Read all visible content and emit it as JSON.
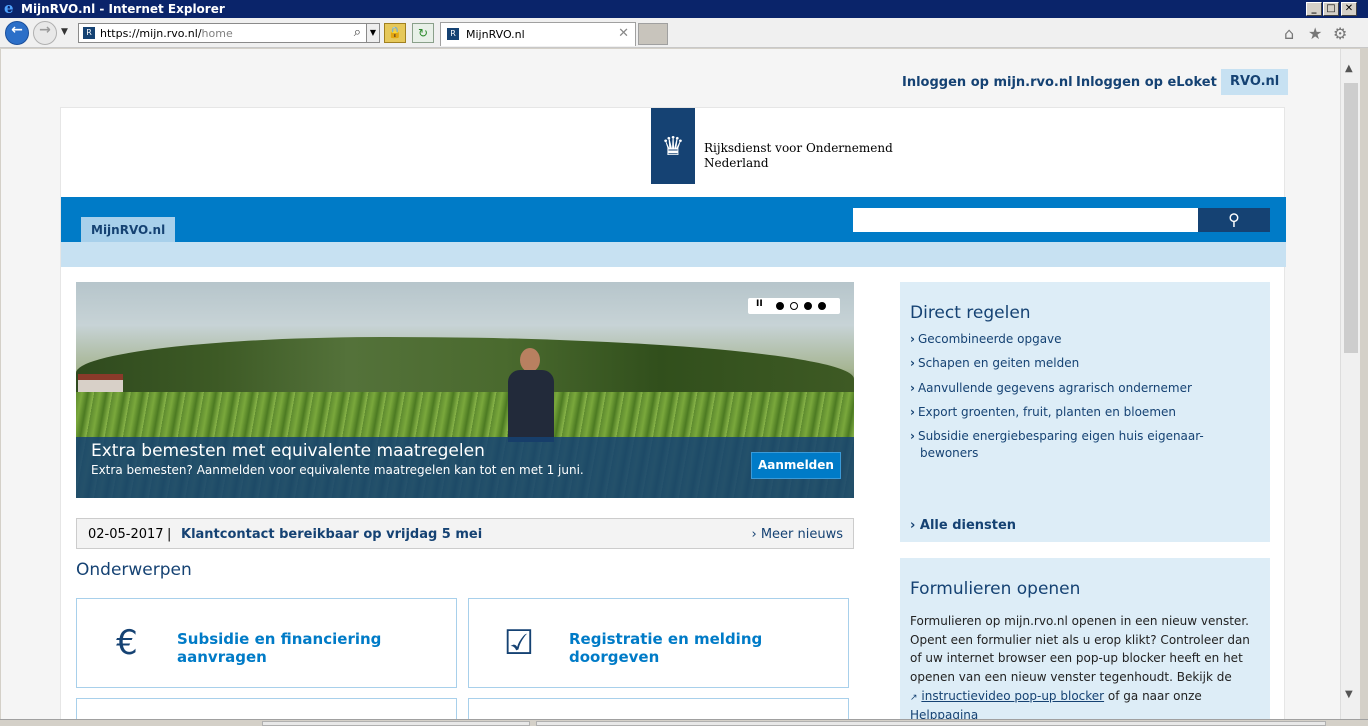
{
  "window": {
    "title": "MijnRVO.nl - Internet Explorer",
    "minimize": "_",
    "maximize": "□",
    "close": "✕"
  },
  "browser": {
    "back": "←",
    "forward": "→",
    "history_dropdown": "▼",
    "url_host": "https://mijn.rvo.nl/",
    "url_path": "home",
    "search_icon": "⌕",
    "address_dropdown": "▼",
    "lock_icon": "🔒",
    "refresh_icon": "↻",
    "tab_label": "MijnRVO.nl",
    "tab_close": "✕",
    "home_icon": "⌂",
    "favorites_icon": "★",
    "settings_icon": "⚙",
    "site_icon": "R"
  },
  "page": {
    "top_links": [
      "Inloggen op mijn.rvo.nl",
      "Inloggen op eLoket",
      "RVO.nl"
    ],
    "logo_line1": "Rijksdienst voor Ondernemend",
    "logo_line2": "Nederland",
    "logo_crest": "♛",
    "nav_home": "MijnRVO.nl",
    "search_placeholder": "",
    "search_icon": "⚲",
    "hero": {
      "title": "Extra bemesten met equivalente maatregelen",
      "subtitle": "Extra bemesten? Aanmelden voor equivalente maatregelen kan tot en met 1 juni.",
      "button": "Aanmelden",
      "pause": "II",
      "active_slide": 2,
      "slide_count": 4
    },
    "news": {
      "date": "02-05-2017",
      "separator": "|",
      "headline": "Klantcontact bereikbaar op vrijdag 5 mei",
      "more": "Meer nieuws"
    },
    "section_title": "Onderwerpen",
    "tiles": [
      {
        "label": "Subsidie en financiering aanvragen",
        "icon": "coins-icon",
        "glyph": "€"
      },
      {
        "label": "Registratie en melding doorgeven",
        "icon": "clipboard-checklist-icon",
        "glyph": "☑"
      }
    ],
    "direct_regelen": {
      "title": "Direct regelen",
      "items": [
        "Gecombineerde opgave",
        "Schapen en geiten melden",
        "Aanvullende gegevens agrarisch ondernemer",
        "Export groenten, fruit, planten en bloemen",
        "Subsidie energiebesparing eigen huis eigenaar-",
        "bewoners"
      ],
      "all": "Alle diensten",
      "chevron": "›"
    },
    "formulieren": {
      "title": "Formulieren openen",
      "lines": [
        "Formulieren op mijn.rvo.nl openen in een nieuw venster.",
        "Opent een formulier niet als u erop klikt? Controleer dan",
        "of uw internet browser een pop-up blocker heeft en het",
        "openen van een nieuw venster tegenhoudt. Bekijk de"
      ],
      "external_icon": "↗",
      "video_link": "instructievideo pop-up blocker",
      "after_link": " of ga naar onze",
      "helppagina": "Helppagina"
    }
  },
  "colors": {
    "rvo_dark_blue": "#154273",
    "rvo_blue": "#007bc7",
    "rvo_light_blue": "#c7e1f2",
    "panel_blue": "#ddedf7"
  }
}
